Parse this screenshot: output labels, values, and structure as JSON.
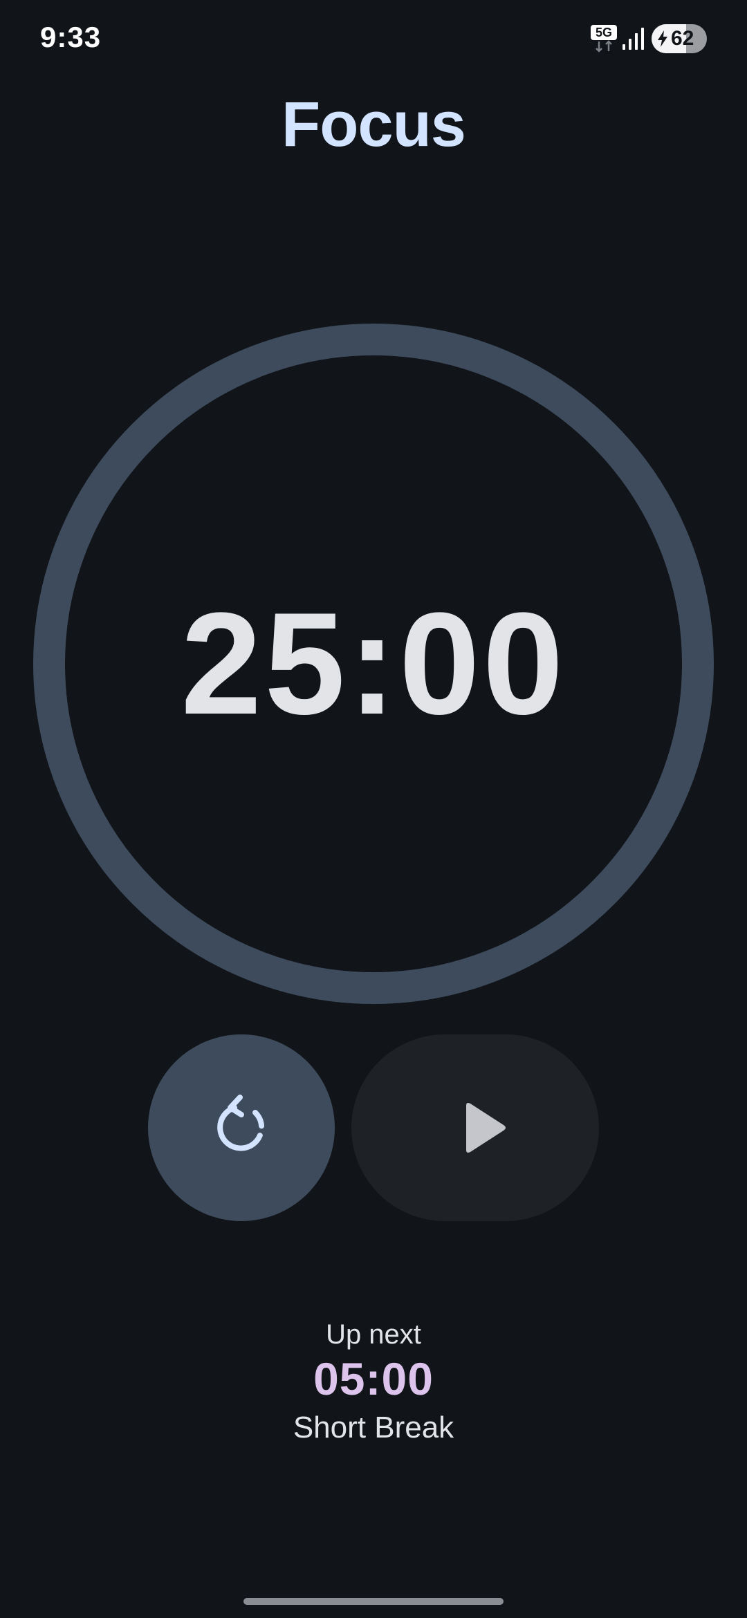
{
  "status_bar": {
    "time": "9:33",
    "network": "5G",
    "battery_level": "62"
  },
  "screen": {
    "title": "Focus"
  },
  "timer": {
    "remaining": "25:00",
    "progress": 1.0
  },
  "controls": {
    "reset_icon": "reset-icon",
    "play_icon": "play-icon"
  },
  "up_next": {
    "label": "Up next",
    "duration": "05:00",
    "name": "Short Break"
  },
  "colors": {
    "background": "#111418",
    "title": "#d2e4ff",
    "ring": "#3d4b5c",
    "reset_button": "#3d4b5c",
    "play_button": "#1e2126",
    "up_next_time": "#dcc4ec"
  }
}
